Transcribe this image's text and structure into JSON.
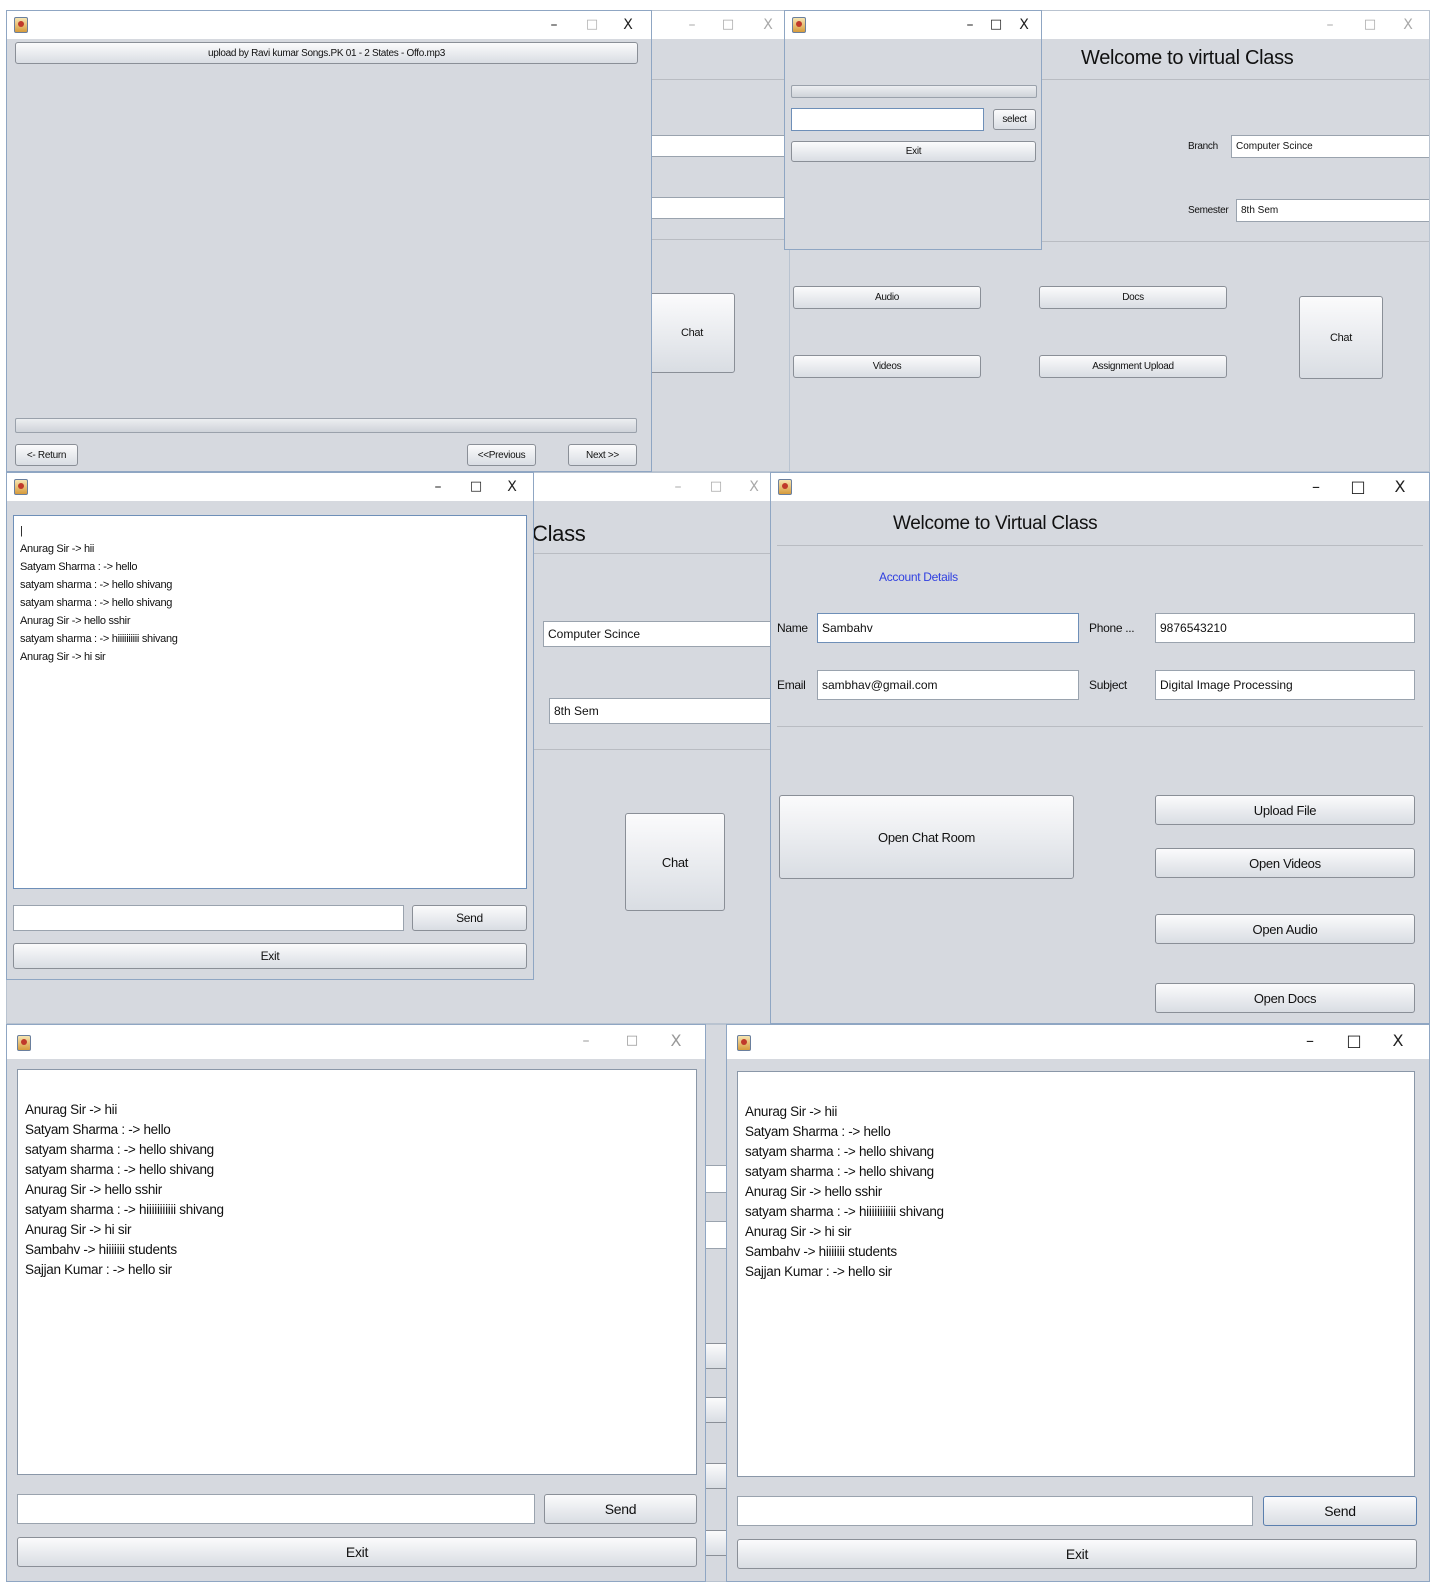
{
  "window_controls": {
    "minimize": "–",
    "maximize": "□",
    "close": "X"
  },
  "win_bg_top_right": {
    "title": "Welcome to virtual Class",
    "branch_label": "Branch",
    "branch_value": "Computer Scince",
    "semester_label": "Semester",
    "semester_value": "8th Sem",
    "audio_button": "Audio",
    "docs_button": "Docs",
    "chat_button": "Chat",
    "videos_button": "Videos",
    "assignment_button": "Assignment Upload"
  },
  "win_bg_left": {
    "chat_button": "Chat"
  },
  "win_upload": {
    "select_button": "select",
    "exit_button": "Exit"
  },
  "win_player": {
    "track_button": "upload by Ravi kumar  Songs.PK 01 - 2 States - Offo.mp3",
    "return_button": "<- Return",
    "previous_button": "<<Previous",
    "next_button": "Next >>"
  },
  "win_bg_middle": {
    "title_fragment": "Class",
    "branch_value": "Computer Scince",
    "semester_value": "8th Sem",
    "chat_button": "Chat"
  },
  "win_small_chat": {
    "cursor": "|",
    "messages": [
      "Anurag Sir  -> hii",
      "Satyam Sharma :  -> hello",
      "satyam sharma :  -> hello shivang",
      "satyam sharma :  -> hello shivang",
      "Anurag Sir  -> hello sshir",
      "satyam sharma :  -> hiiiiiiiiii shivang",
      "Anurag Sir  -> hi sir"
    ],
    "send_button": "Send",
    "exit_button": "Exit"
  },
  "win_teacher": {
    "title": "Welcome to Virtual Class",
    "account_details": "Account Details",
    "name_label": "Name",
    "name_value": "Sambahv",
    "phone_label": "Phone ...",
    "phone_value": "9876543210",
    "email_label": "Email",
    "email_value": "sambhav@gmail.com",
    "subject_label": "Subject",
    "subject_value": "Digital Image Processing",
    "chat_room_button": "Open Chat Room",
    "upload_file_button": "Upload File",
    "open_videos_button": "Open Videos",
    "open_audio_button": "Open Audio",
    "open_docs_button": "Open Docs"
  },
  "win_chat_left": {
    "messages": [
      "Anurag Sir  -> hii",
      "Satyam Sharma :  -> hello",
      "satyam sharma :  -> hello shivang",
      "satyam sharma :  -> hello shivang",
      "Anurag Sir  -> hello sshir",
      "satyam sharma :  -> hiiiiiiiiiii shivang",
      "Anurag Sir  -> hi sir",
      "Sambahv  -> hiiiiiii students",
      "Sajjan Kumar :  -> hello sir"
    ],
    "send_button": "Send",
    "exit_button": "Exit"
  },
  "win_chat_right": {
    "messages": [
      "Anurag Sir  -> hii",
      "Satyam Sharma :  -> hello",
      "satyam sharma :  -> hello shivang",
      "satyam sharma :  -> hello shivang",
      "Anurag Sir  -> hello sshir",
      "satyam sharma :  -> hiiiiiiiiiii shivang",
      "Anurag Sir  -> hi sir",
      "Sambahv  -> hiiiiiii students",
      "Sajjan Kumar :  -> hello sir"
    ],
    "send_button": "Send",
    "exit_button": "Exit"
  }
}
